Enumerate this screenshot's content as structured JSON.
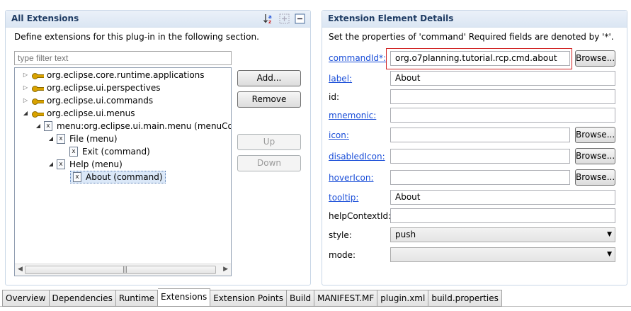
{
  "left": {
    "title": "All Extensions",
    "description": "Define extensions for this plug-in in the following section.",
    "filter_placeholder": "type filter text",
    "tree": [
      {
        "label": "org.eclipse.core.runtime.applications"
      },
      {
        "label": "org.eclipse.ui.perspectives"
      },
      {
        "label": "org.eclipse.ui.commands"
      },
      {
        "label": "org.eclipse.ui.menus"
      },
      {
        "label": "menu:org.eclipse.ui.main.menu (menuContrib"
      },
      {
        "label": "File (menu)"
      },
      {
        "label": "Exit (command)"
      },
      {
        "label": "Help (menu)"
      },
      {
        "label": "About (command)"
      }
    ],
    "buttons": {
      "add": "Add...",
      "remove": "Remove",
      "up": "Up",
      "down": "Down"
    },
    "tools": [
      "sort-icon",
      "collapse-toggle-icon",
      "collapse-all-icon"
    ]
  },
  "right": {
    "title": "Extension Element Details",
    "description": "Set the properties of 'command' Required fields are denoted by '*'.",
    "browse_label": "Browse...",
    "fields": {
      "commandId": {
        "label": "commandId*:",
        "value": "org.o7planning.tutorial.rcp.cmd.about"
      },
      "label": {
        "label": "label:",
        "value": "About"
      },
      "id": {
        "label": "id:",
        "value": ""
      },
      "mnemonic": {
        "label": "mnemonic:",
        "value": ""
      },
      "icon": {
        "label": "icon:",
        "value": ""
      },
      "disabledIcon": {
        "label": "disabledIcon:",
        "value": ""
      },
      "hoverIcon": {
        "label": "hoverIcon:",
        "value": ""
      },
      "tooltip": {
        "label": "tooltip:",
        "value": "About"
      },
      "helpContextId": {
        "label": "helpContextId:",
        "value": ""
      },
      "style": {
        "label": "style:",
        "value": "push"
      },
      "mode": {
        "label": "mode:",
        "value": ""
      }
    }
  },
  "tabs": [
    "Overview",
    "Dependencies",
    "Runtime",
    "Extensions",
    "Extension Points",
    "Build",
    "MANIFEST.MF",
    "plugin.xml",
    "build.properties"
  ],
  "active_tab": "Extensions",
  "colors": {
    "link": "#1a4ed8",
    "section_title": "#1f3c64",
    "highlight_border": "#d02020"
  }
}
